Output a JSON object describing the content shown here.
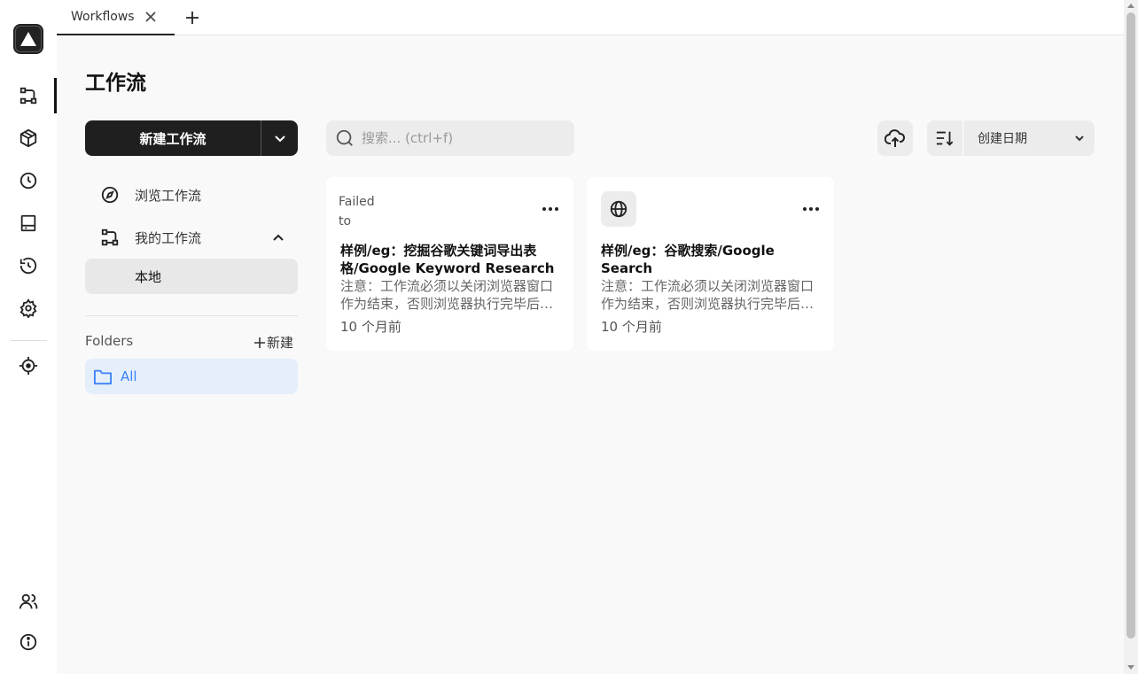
{
  "tabs": [
    {
      "label": "Workflows"
    }
  ],
  "page": {
    "title": "工作流"
  },
  "actions": {
    "new_workflow": "新建工作流",
    "search_placeholder": "搜索... (ctrl+f)",
    "sort_label": "创建日期"
  },
  "sidebar": {
    "items": [
      {
        "label": "浏览工作流",
        "icon": "compass-icon"
      },
      {
        "label": "我的工作流",
        "icon": "workflow-icon"
      }
    ],
    "local_label": "本地",
    "folders_label": "Folders",
    "folders_new": "新建",
    "folder_all": "All"
  },
  "cards": [
    {
      "thumb_text": "Failed to",
      "title": "样例/eg：挖掘谷歌关键词导出表格/Google Keyword Research",
      "description": "注意：工作流必须以关闭浏览器窗口作为结束，否则浏览器执行完毕后不会自动关闭",
      "time": "10 个月前"
    },
    {
      "icon": "globe-icon",
      "title": "样例/eg：谷歌搜索/Google Search",
      "description": "注意：工作流必须以关闭浏览器窗口作为结束，否则浏览器执行完毕后不会自动关闭",
      "time": "10 个月前"
    }
  ],
  "rail_icons": [
    "workflow-icon",
    "package-icon",
    "clock-icon",
    "storage-icon",
    "history-icon",
    "settings-icon",
    "crosshair-icon",
    "users-icon",
    "info-icon"
  ],
  "colors": {
    "accent": "#1f1f1f",
    "folder_active_bg": "#e5eefb",
    "folder_active_text": "#3b82f6"
  }
}
